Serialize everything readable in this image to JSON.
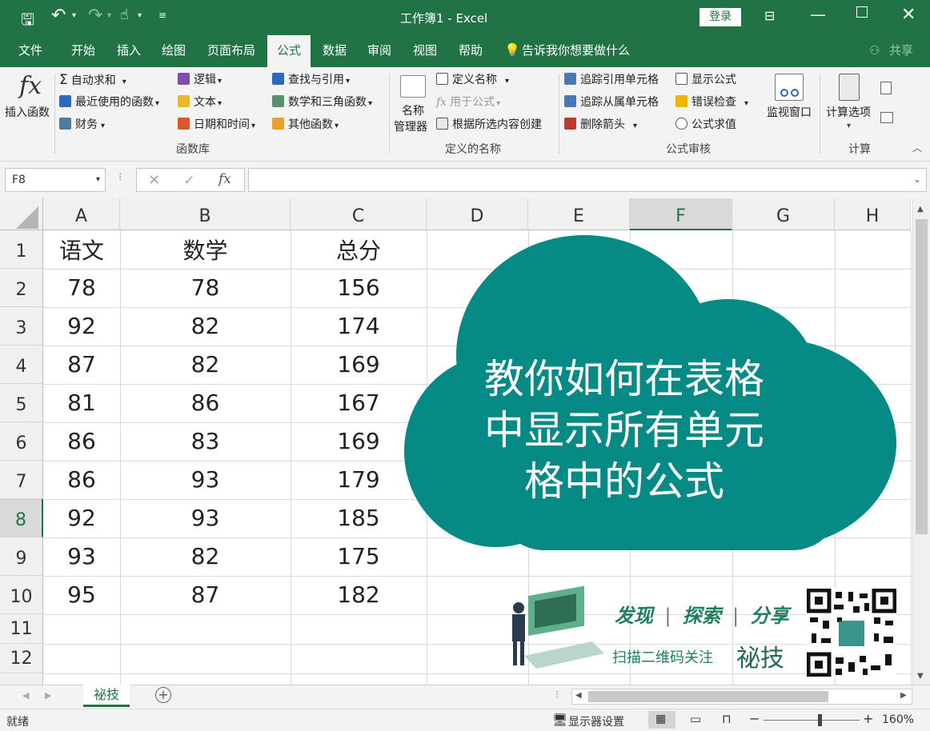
{
  "window": {
    "title": "工作簿1  -  Excel",
    "login_label": "登录"
  },
  "menu": {
    "tabs": [
      "文件",
      "开始",
      "插入",
      "绘图",
      "页面布局",
      "公式",
      "数据",
      "审阅",
      "视图",
      "帮助"
    ],
    "active": "公式",
    "tell_me": "告诉我你想要做什么",
    "share": "共享"
  },
  "ribbon": {
    "insert_function": "插入函数",
    "library": {
      "autosum": "自动求和",
      "recent": "最近使用的函数",
      "financial": "财务",
      "logical": "逻辑",
      "text": "文本",
      "datetime": "日期和时间",
      "lookup": "查找与引用",
      "math": "数学和三角函数",
      "other": "其他函数",
      "group_label": "函数库"
    },
    "names": {
      "name_manager_1": "名称",
      "name_manager_2": "管理器",
      "define_name": "定义名称",
      "use_in_formula": "用于公式",
      "create_from_selection": "根据所选内容创建",
      "group_label": "定义的名称"
    },
    "audit": {
      "trace_precedents": "追踪引用单元格",
      "trace_dependents": "追踪从属单元格",
      "remove_arrows": "删除箭头",
      "show_formulas": "显示公式",
      "error_checking": "错误检查",
      "evaluate_formula": "公式求值",
      "watch_window": "监视窗口",
      "group_label": "公式审核"
    },
    "calc": {
      "options": "计算选项",
      "group_label": "计算"
    }
  },
  "formula_bar": {
    "name_box": "F8",
    "fx": "fx",
    "content": ""
  },
  "grid": {
    "columns": [
      "A",
      "B",
      "C",
      "D",
      "E",
      "F",
      "G",
      "H"
    ],
    "selected_column": "F",
    "rows": [
      "1",
      "2",
      "3",
      "4",
      "5",
      "6",
      "7",
      "8",
      "9",
      "10",
      "11",
      "12"
    ],
    "selected_row": "8",
    "headers": [
      "语文",
      "数学",
      "总分"
    ],
    "data": [
      [
        "78",
        "78",
        "156"
      ],
      [
        "92",
        "82",
        "174"
      ],
      [
        "87",
        "82",
        "169"
      ],
      [
        "81",
        "86",
        "167"
      ],
      [
        "86",
        "83",
        "169"
      ],
      [
        "86",
        "93",
        "179"
      ],
      [
        "92",
        "93",
        "185"
      ],
      [
        "93",
        "82",
        "175"
      ],
      [
        "95",
        "87",
        "182"
      ]
    ]
  },
  "overlay": {
    "cloud_line1": "教你如何在表格",
    "cloud_line2": "中显示所有单元",
    "cloud_line3": "格中的公式",
    "slogan_1": "发现",
    "slogan_2": "探索",
    "slogan_3": "分享",
    "scan_text": "扫描二维码关注",
    "brand": "祕技",
    "teal": "#058a86"
  },
  "sheets": {
    "tabs": [
      "祕技"
    ]
  },
  "status": {
    "ready": "就绪",
    "display_settings": "显示器设置",
    "zoom": "160%"
  },
  "colors": {
    "excel_green": "#217346"
  }
}
